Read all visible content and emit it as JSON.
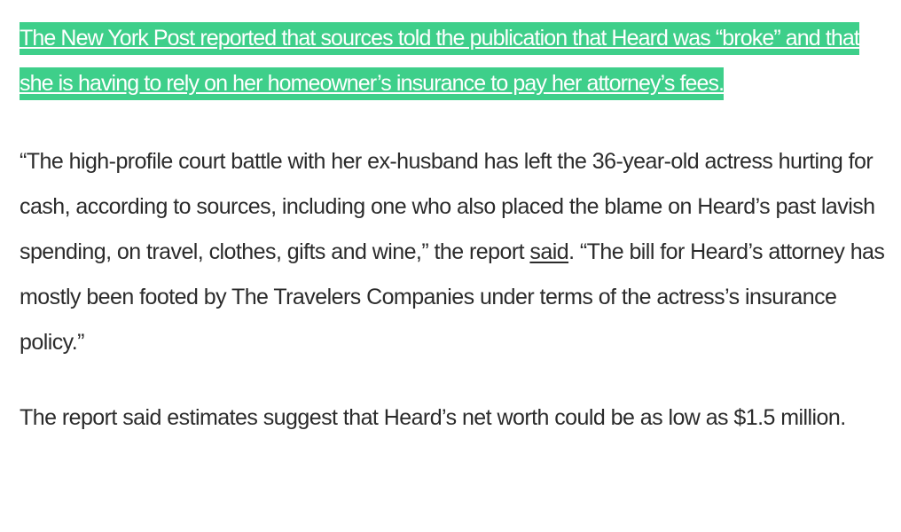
{
  "article": {
    "highlighted_paragraph": "The New York Post reported that sources told the publication that Heard was “broke” and that she is having to rely on her homeowner’s insurance to pay her attorney’s fees.",
    "quote_paragraph": {
      "before_link": "“The high-profile court battle with her ex-husband has left the 36-year-old actress hurting for cash, according to sources, including one who also placed the blame on Heard’s past lavish spending, on travel, clothes, gifts and wine,” the report ",
      "link_text": "said",
      "after_link": ". “The bill for Heard’s attorney has mostly been footed by The Travelers Companies under terms of the actress’s insurance policy.”"
    },
    "estimate_paragraph": "The report said estimates suggest that Heard’s net worth could be as low as $1.5 million.",
    "colors": {
      "highlight": "#3ecf8a",
      "highlight_text": "#ffffff",
      "body_text": "#2b2b2b"
    }
  }
}
